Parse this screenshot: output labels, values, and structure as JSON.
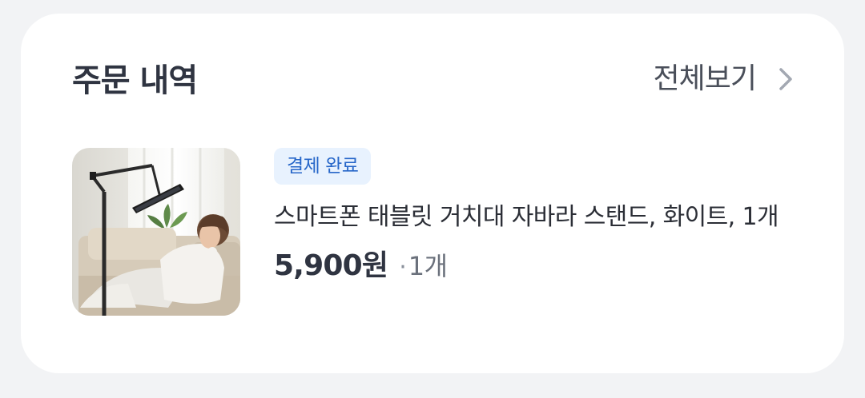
{
  "section": {
    "title": "주문 내역",
    "view_all_label": "전체보기",
    "view_all_icon": "chevron-right-icon"
  },
  "order": {
    "status_badge": "결제 완료",
    "product_name": "스마트폰 태블릿 거치대 자바라 스탠드, 화이트, 1개",
    "price": "5,900원",
    "separator": "·",
    "quantity": "1개",
    "thumbnail_alt": "product-photo"
  },
  "colors": {
    "background": "#f2f3f5",
    "card": "#ffffff",
    "badge_bg": "#e8f2fe",
    "badge_text": "#2767c9",
    "title_text": "#2f3441"
  }
}
